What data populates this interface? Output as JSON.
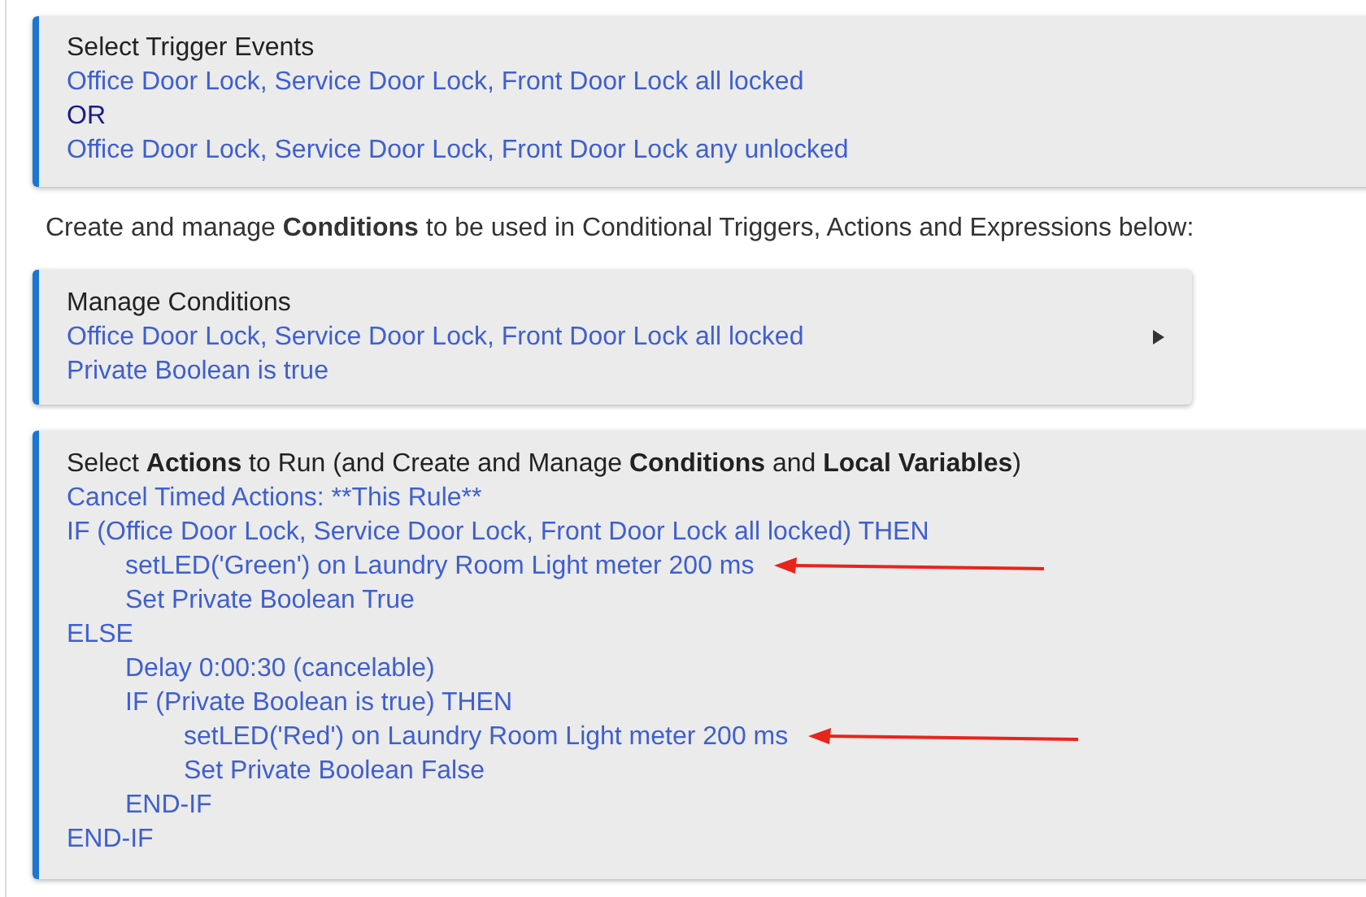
{
  "trigger_card": {
    "title": "Select Trigger Events",
    "lines": [
      {
        "kind": "event",
        "text": "Office Door Lock, Service Door Lock, Front Door Lock all locked"
      },
      {
        "kind": "operator",
        "text": "OR"
      },
      {
        "kind": "event",
        "text": "Office Door Lock, Service Door Lock, Front Door Lock any unlocked"
      }
    ]
  },
  "description": "Create and manage **Conditions** to be used in Conditional Triggers, Actions and Expressions below:",
  "conditions_card": {
    "title": "Manage Conditions",
    "lines": [
      "Office Door Lock, Service Door Lock, Front Door Lock all locked",
      "Private Boolean is true"
    ]
  },
  "actions_card": {
    "title": "Select **Actions** to Run (and Create and Manage **Conditions** and **Local Variables**)",
    "lines": [
      {
        "text": "Cancel Timed Actions: **This Rule**",
        "marked": false
      },
      {
        "text": "IF (Office Door Lock, Service Door Lock, Front Door Lock all locked) THEN",
        "marked": false,
        "children": [
          {
            "text": "setLED('Green') on Laundry Room Light meter 200 ms",
            "marked": true
          },
          {
            "text": "Set Private Boolean True",
            "marked": false
          }
        ]
      },
      {
        "text": "ELSE",
        "marked": false,
        "children": [
          {
            "text": "Delay 0:00:30 (cancelable)",
            "marked": false
          },
          {
            "text": "IF (Private Boolean is true) THEN",
            "marked": false,
            "children": [
              {
                "text": "setLED('Red') on Laundry Room Light meter 200 ms",
                "marked": true
              },
              {
                "text": "Set Private Boolean False",
                "marked": false
              }
            ]
          },
          {
            "text": "END-IF",
            "marked": false
          }
        ]
      },
      {
        "text": "END-IF",
        "marked": false
      }
    ]
  }
}
